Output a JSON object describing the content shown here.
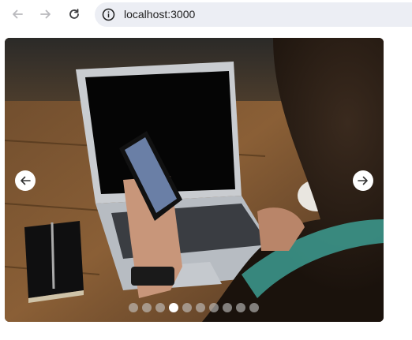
{
  "browser": {
    "url": "localhost:3000",
    "back_icon": "arrow-left-icon",
    "forward_icon": "arrow-right-icon",
    "reload_icon": "reload-icon",
    "site_info_icon": "info-icon"
  },
  "carousel": {
    "prev_icon": "arrow-left-icon",
    "next_icon": "arrow-right-icon",
    "slide_count": 10,
    "active_index": 3
  }
}
